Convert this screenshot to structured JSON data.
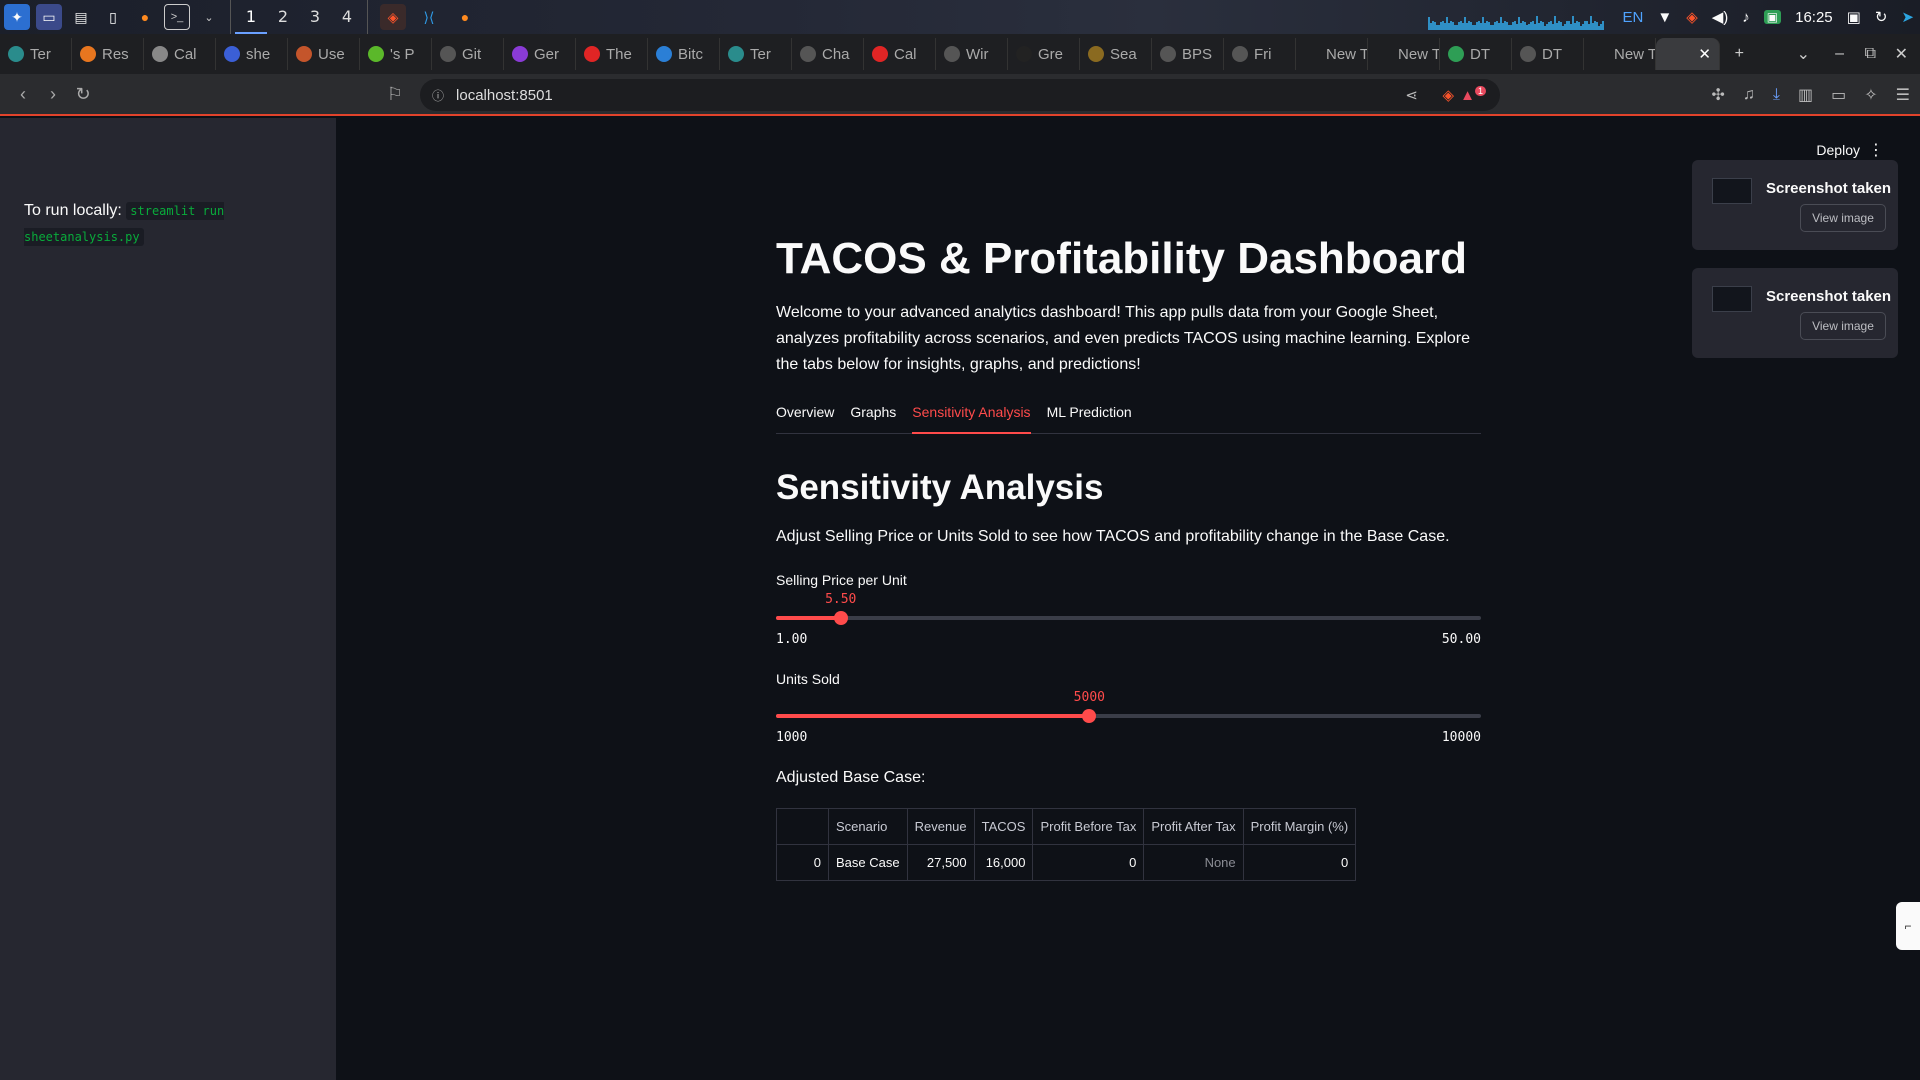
{
  "taskbar": {
    "workspaces": [
      "1",
      "2",
      "3",
      "4"
    ],
    "language": "EN",
    "time": "16:25"
  },
  "browser_tabs": [
    "Ter",
    "Res",
    "Cal",
    "she",
    "Use",
    "'s P",
    "Git",
    "Ger",
    "The",
    "Bitc",
    "Ter",
    "Cha",
    "Cal",
    "Wir",
    "Gre",
    "Sea",
    "BPS",
    "Fri",
    "New T",
    "New T",
    "DT",
    "DT",
    "New T",
    ""
  ],
  "browser": {
    "url": "localhost:8501",
    "notif_count": "1"
  },
  "sidebar": {
    "text": "To run locally:",
    "code": "streamlit run sheetanalysis.py"
  },
  "header": {
    "deploy": "Deploy"
  },
  "main": {
    "title": "TACOS & Profitability Dashboard",
    "intro": "Welcome to your advanced analytics dashboard! This app pulls data from your Google Sheet, analyzes profitability across scenarios, and even predicts TACOS using machine learning. Explore the tabs below for insights, graphs, and predictions!",
    "tabs": [
      "Overview",
      "Graphs",
      "Sensitivity Analysis",
      "ML Prediction"
    ],
    "active_tab": 2,
    "section_title": "Sensitivity Analysis",
    "section_desc": "Adjust Selling Price or Units Sold to see how TACOS and profitability change in the Base Case.",
    "sliders": [
      {
        "label": "Selling Price per Unit",
        "value": "5.50",
        "min": "1.00",
        "max": "50.00",
        "num_value": 5.5,
        "num_min": 1,
        "num_max": 50
      },
      {
        "label": "Units Sold",
        "value": "5000",
        "min": "1000",
        "max": "10000",
        "num_value": 5000,
        "num_min": 1000,
        "num_max": 10000
      }
    ],
    "adjusted_label": "Adjusted Base Case:",
    "table": {
      "columns": [
        "",
        "Scenario",
        "Revenue",
        "TACOS",
        "Profit Before Tax",
        "Profit After Tax",
        "Profit Margin (%)"
      ],
      "rows": [
        [
          "0",
          "Base Case",
          "27,500",
          "16,000",
          "0",
          "None",
          "0"
        ]
      ]
    }
  },
  "toasts": [
    {
      "title": "Screenshot taken",
      "button": "View image"
    },
    {
      "title": "Screenshot taken",
      "button": "View image"
    }
  ],
  "colors": {
    "accent": "#ff4b4b",
    "background": "#0e1117",
    "sidebar": "#262730",
    "code_green": "#09ab3b"
  }
}
